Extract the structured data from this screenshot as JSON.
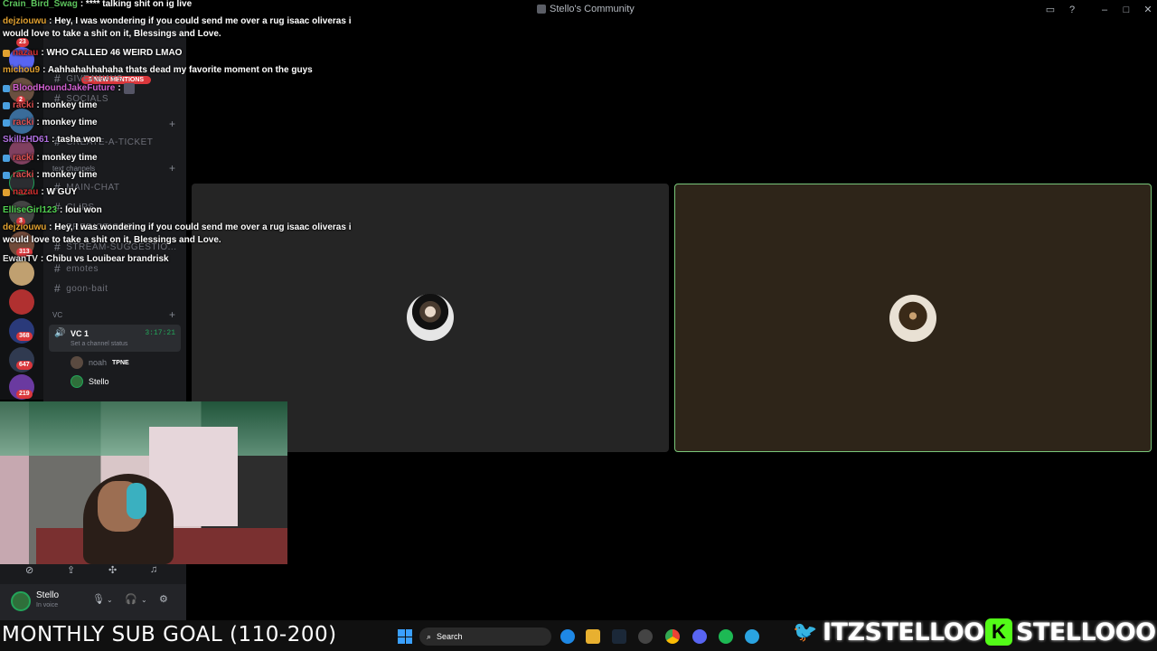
{
  "window": {
    "title": "Stello's Community"
  },
  "sidebar": {
    "server_badges": [
      "23",
      "2",
      "3",
      "313",
      "368",
      "647",
      "219"
    ],
    "mentions_banner": "3 NEW MENTIONS",
    "channels": [
      {
        "name": "GIVEAWAYS"
      },
      {
        "name": "SOCIALS"
      },
      {
        "name": "CREATE-A-TICKET"
      },
      {
        "name": "MAIN-CHAT"
      },
      {
        "name": "CLIPS"
      },
      {
        "name": "PREDICTIONS"
      },
      {
        "name": "STREAM-SUGGESTIO..."
      },
      {
        "name": "emotes"
      },
      {
        "name": "goon-bait"
      }
    ],
    "text_category": "text channels",
    "vc_category": "VC",
    "voice_channel": {
      "name": "VC 1",
      "timer": "3:17:21",
      "status": "Set a channel status",
      "users": [
        {
          "name": "noah",
          "tag": "TPNE"
        },
        {
          "name": "Stello",
          "tag": ""
        }
      ]
    }
  },
  "user_panel": {
    "name": "Stello",
    "status": "In voice"
  },
  "chat": [
    {
      "user": "Crain_Bird_Swag",
      "color": "#5cc45c",
      "text": ": **** talking shit on ig live"
    },
    {
      "user": "dejziouwu",
      "color": "#e0a030",
      "text": ": Hey, I was wondering if you could send me over a rug isaac oliveras i would love to take a shit on it, Blessings and Love."
    },
    {
      "user": "nazau",
      "color": "#d03030",
      "text": ": WHO CALLED 46 WEIRD LMAO"
    },
    {
      "user": "michou9",
      "color": "#e0a030",
      "text": ": Aahhahahhahaha thats dead my favorite moment on the guys"
    },
    {
      "user": "BloodHoundJakeFuture",
      "color": "#d060d0",
      "text": ":"
    },
    {
      "user": "racki",
      "color": "#e05050",
      "text": ": monkey time"
    },
    {
      "user": "racki",
      "color": "#e05050",
      "text": ": monkey time"
    },
    {
      "user": "SkillzHD61",
      "color": "#b070e0",
      "text": ": tasha won"
    },
    {
      "user": "racki",
      "color": "#e05050",
      "text": ": monkey time"
    },
    {
      "user": "racki",
      "color": "#e05050",
      "text": ": monkey time"
    },
    {
      "user": "nazau",
      "color": "#d03030",
      "text": ": W GUY"
    },
    {
      "user": "ElliseGirl123",
      "color": "#50d050",
      "text": ": loui won"
    },
    {
      "user": "dejziouwu",
      "color": "#e0a030",
      "text": ": Hey, I was wondering if you could send me over a rug isaac oliveras i would love to take a shit on it, Blessings and Love."
    },
    {
      "user": "EwanTV",
      "color": "#e0e0e0",
      "text": ": Chibu vs Louibear brandrisk"
    }
  ],
  "overlay": {
    "sub_goal": "MONTHLY SUB GOAL (110-200)",
    "twitter_handle": "ITZSTELLOO",
    "kick_handle": "STELLOOO"
  },
  "taskbar": {
    "search_placeholder": "Search"
  },
  "colors": {
    "speaking_border": "#7ac77a",
    "discord_red": "#da373c",
    "voice_green": "#23a55a"
  }
}
